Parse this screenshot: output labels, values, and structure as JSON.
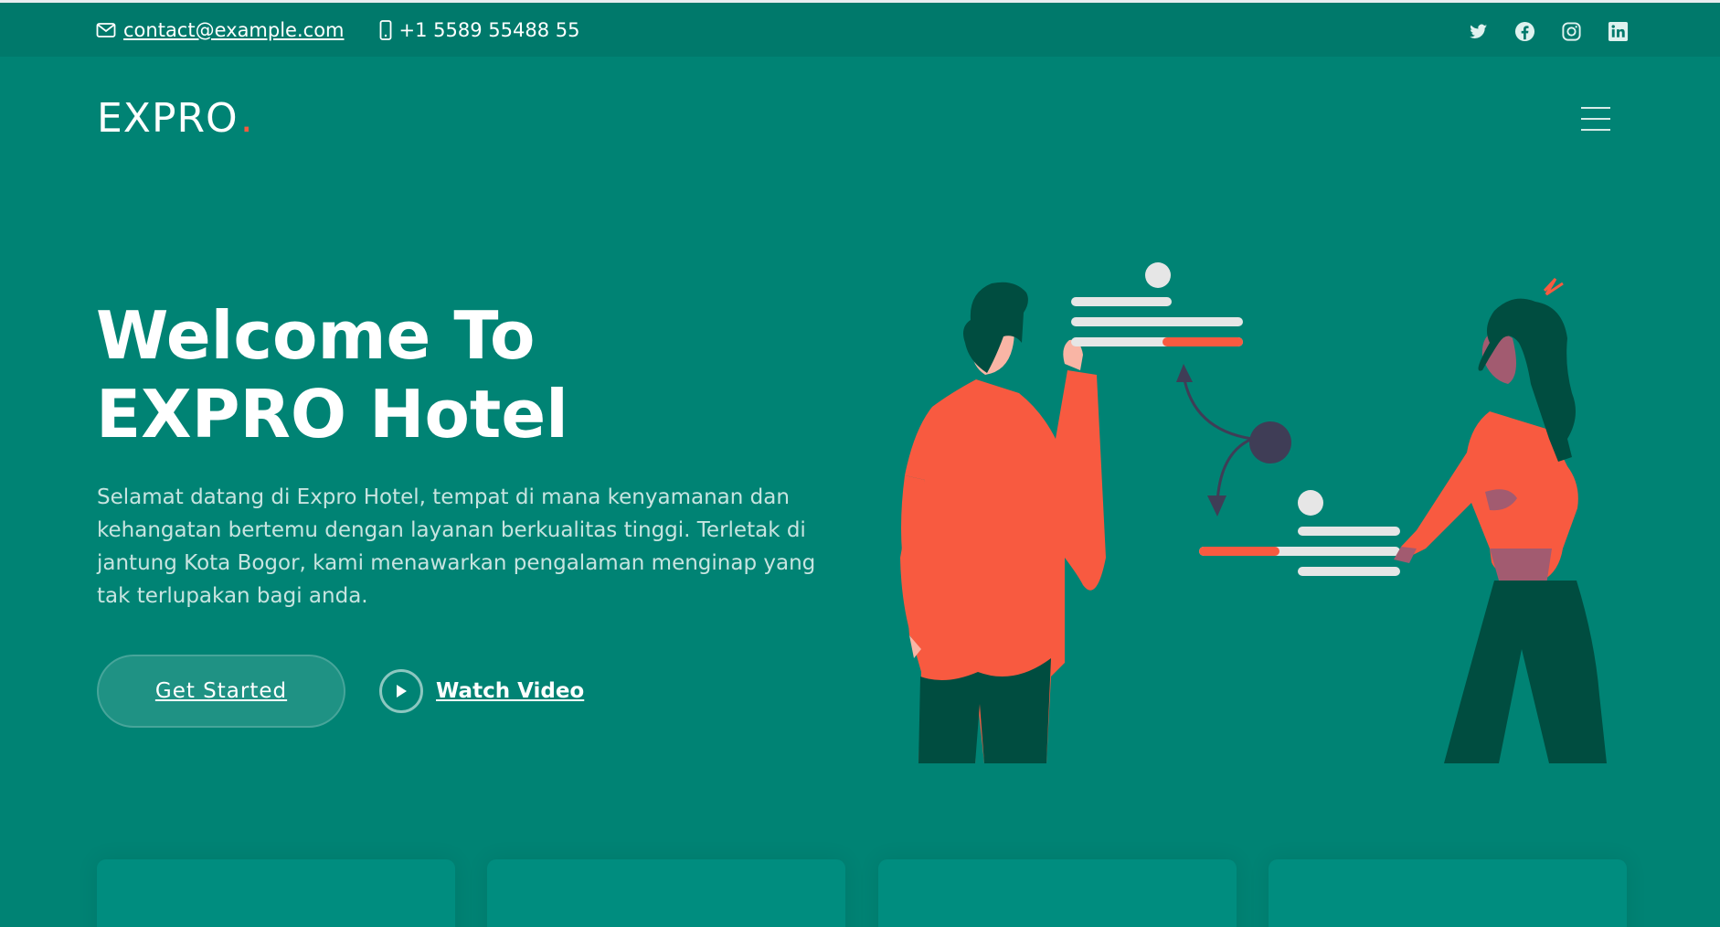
{
  "topbar": {
    "email": "contact@example.com",
    "phone": "+1 5589 55488 55",
    "social": [
      "twitter-icon",
      "facebook-icon",
      "instagram-icon",
      "linkedin-icon"
    ]
  },
  "header": {
    "logo": "EXPRO",
    "logo_dot": "."
  },
  "hero": {
    "title_line1": "Welcome To",
    "title_line2": "EXPRO Hotel",
    "description": "Selamat datang di Expro Hotel, tempat di mana kenyamanan dan kehangatan bertemu dengan layanan berkualitas tinggi. Terletak di jantung Kota Bogor, kami menawarkan pengalaman menginap yang tak terlupakan bagi anda.",
    "cta_primary": "Get Started",
    "cta_secondary": "Watch Video"
  },
  "colors": {
    "background": "#008374",
    "topbar": "#00796b",
    "accent": "#f85a40",
    "dark_green": "#004d40"
  }
}
